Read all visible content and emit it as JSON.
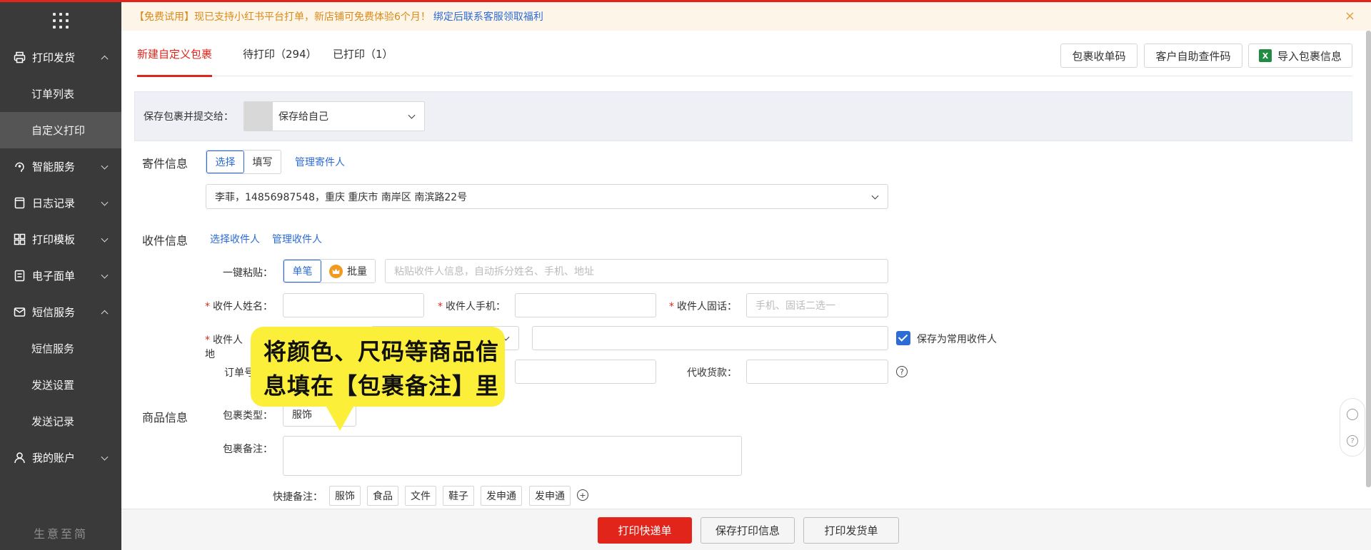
{
  "sidebar": {
    "items": [
      {
        "label": "打印发货",
        "icon": "printer-icon",
        "expanded": true,
        "children": [
          "订单列表",
          "自定义打印"
        ]
      },
      {
        "label": "智能服务",
        "icon": "smart-service-icon",
        "expanded": false
      },
      {
        "label": "日志记录",
        "icon": "log-icon",
        "expanded": false
      },
      {
        "label": "打印模板",
        "icon": "template-icon",
        "expanded": false
      },
      {
        "label": "电子面单",
        "icon": "waybill-icon",
        "expanded": false
      },
      {
        "label": "短信服务",
        "icon": "mail-icon",
        "expanded": true,
        "children": [
          "短信服务",
          "发送设置",
          "发送记录"
        ]
      },
      {
        "label": "我的账户",
        "icon": "user-icon",
        "expanded": false
      }
    ],
    "active_sub": "自定义打印",
    "brand": "生意至简"
  },
  "notice": {
    "text": "【免费试用】现已支持小红书平台打单，新店铺可免费体验6个月！",
    "link": "绑定后联系客服领取福利",
    "close": "×"
  },
  "tabs": [
    {
      "label": "新建自定义包裹",
      "active": true
    },
    {
      "label": "待打印（294）",
      "active": false
    },
    {
      "label": "已打印（1）",
      "active": false
    }
  ],
  "toolbar": {
    "parcel_code": "包裹收单码",
    "self_query": "客户自助查件码",
    "import": "导入包裹信息",
    "xls_glyph": "X"
  },
  "save": {
    "label": "保存包裹并提交给：",
    "value": "保存给自己"
  },
  "sender": {
    "title": "寄件信息",
    "seg": [
      "选择",
      "填写"
    ],
    "manage": "管理寄件人",
    "address": "李菲，14856987548，重庆 重庆市 南岸区 南滨路22号"
  },
  "receiver": {
    "title": "收件信息",
    "select": "选择收件人",
    "manage": "管理收件人",
    "paste_label": "一键粘贴：",
    "paste_seg": [
      "单笔",
      "批量"
    ],
    "paste_placeholder": "粘贴收件人信息，自动拆分姓名、手机、地址",
    "name_label": "收件人姓名：",
    "mobile_label": "收件人手机：",
    "phone_label": "收件人固话：",
    "phone_placeholder": "手机、固话二选一",
    "address_label_visible": "收件人地",
    "save_common": "保存为常用收件人",
    "order_label_visible": "订单号",
    "cod_label": "代收货款：",
    "help": "?"
  },
  "goods": {
    "title": "商品信息",
    "type_label": "包裹类型：",
    "type_value": "服饰",
    "note_label": "包裹备注：",
    "quick_label": "快捷备注：",
    "quick_tags": [
      "服饰",
      "食品",
      "文件",
      "鞋子",
      "发申通",
      "发申通"
    ],
    "add": "+"
  },
  "tooltip": {
    "line1": "将颜色、尺码等商品信",
    "line2": "息填在【包裹备注】里"
  },
  "footer": {
    "print_express": "打印快递单",
    "save_print": "保存打印信息",
    "print_ship": "打印发货单"
  },
  "colors": {
    "accent": "#e1251b",
    "link": "#2d6bd6",
    "sidebar": "#3a3a3a",
    "tooltip": "#fcef3a"
  }
}
